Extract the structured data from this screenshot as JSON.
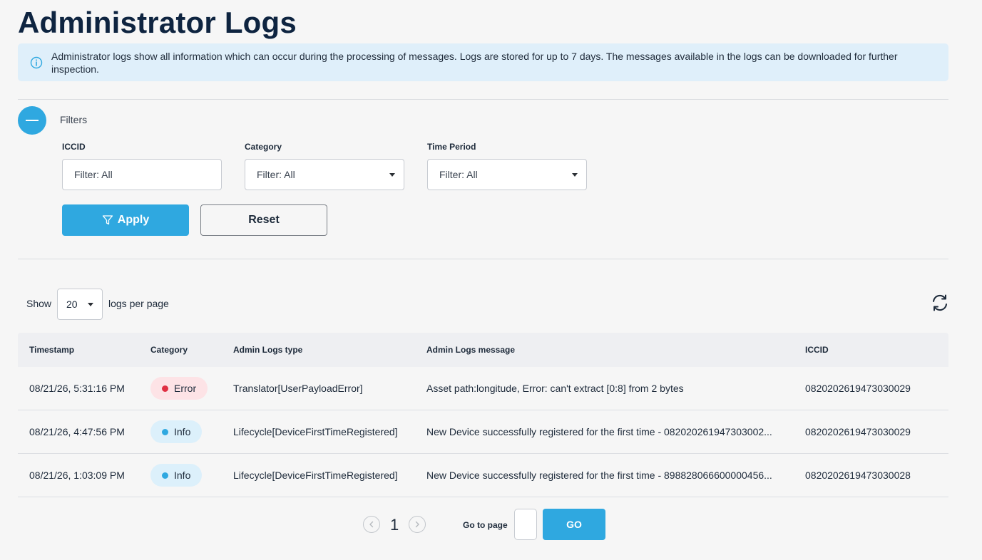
{
  "page": {
    "title": "Administrator Logs",
    "info_text": "Administrator logs show all information which can occur during the processing of messages. Logs are stored for up to 7 days. The messages available in the logs can be downloaded for further inspection."
  },
  "filters": {
    "label": "Filters",
    "iccid": {
      "label": "ICCID",
      "placeholder": "Filter: All"
    },
    "category": {
      "label": "Category",
      "value": "Filter: All"
    },
    "time_period": {
      "label": "Time Period",
      "value": "Filter: All"
    },
    "apply_label": "Apply",
    "reset_label": "Reset"
  },
  "pagination_size": {
    "show_label": "Show",
    "value": "20",
    "suffix_label": "logs per page"
  },
  "table": {
    "headers": [
      "Timestamp",
      "Category",
      "Admin Logs type",
      "Admin Logs message",
      "ICCID"
    ],
    "rows": [
      {
        "timestamp": "08/21/26, 5:31:16 PM",
        "category": "Error",
        "type": "Translator[UserPayloadError]",
        "message": "Asset path:longitude, Error: can't extract [0:8] from 2 bytes",
        "iccid": "08202026194730300​29"
      },
      {
        "timestamp": "08/21/26, 4:47:56 PM",
        "category": "Info",
        "type": "Lifecycle[DeviceFirstTimeRegistered]",
        "message": "New Device successfully registered for the first time - 082020261947303002...",
        "iccid": "0820202619473030029"
      },
      {
        "timestamp": "08/21/26, 1:03:09 PM",
        "category": "Info",
        "type": "Lifecycle[DeviceFirstTimeRegistered]",
        "message": "New Device successfully registered for the first time - 898828066600000456...",
        "iccid": "0820202619473030028"
      }
    ]
  },
  "pager": {
    "current_page": "1",
    "goto_label": "Go to page",
    "go_label": "GO"
  },
  "colors": {
    "accent": "#2fa8e0",
    "error": "#e03043",
    "banner_bg": "#dfeffa"
  }
}
